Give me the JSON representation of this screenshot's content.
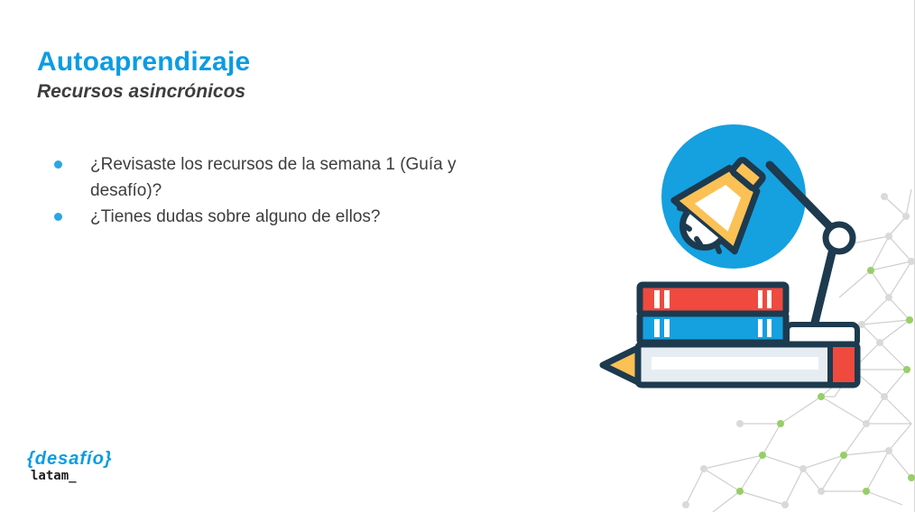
{
  "slide": {
    "title": "Autoaprendizaje",
    "subtitle": "Recursos asincrónicos"
  },
  "bullets": [
    "¿Revisaste los recursos de la semana 1 (Guía y desafío)?",
    "¿Tienes dudas sobre alguno de ellos?"
  ],
  "illustration": {
    "icon": "books-lamp-pencil-icon",
    "background_decoration": "network-mesh-icon"
  },
  "logo": {
    "top_text": "{desafío}",
    "bottom_text": "latam_"
  },
  "colors": {
    "accent_blue": "#0a9ce3",
    "text_dark": "#3d3d3d",
    "red": "#f0493e",
    "yellow": "#fcc155",
    "navy": "#1d3a4e",
    "mesh_green": "#97cf67"
  }
}
